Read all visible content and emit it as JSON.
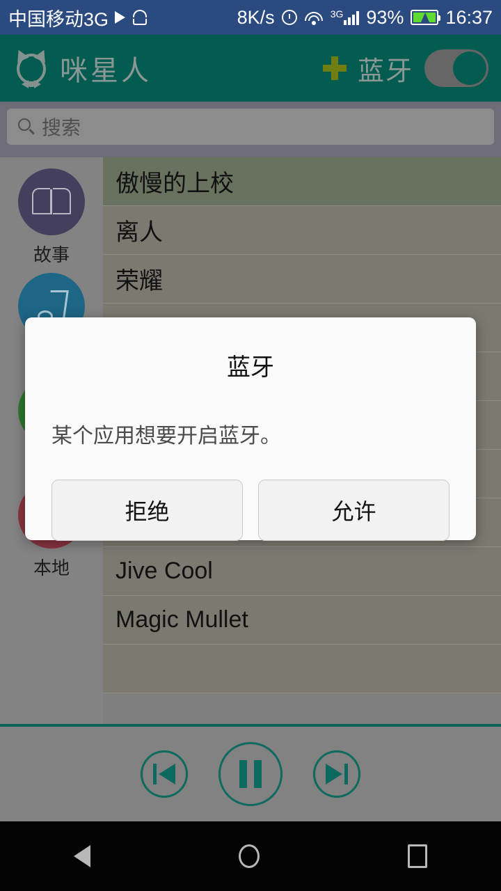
{
  "status_bar": {
    "carrier": "中国移动3G",
    "play_icon": "play-icon",
    "android_icon": "android-robot-icon",
    "net_speed": "8K/s",
    "alarm_icon": "alarm-icon",
    "wifi_icon": "wifi-icon",
    "signal_label": "3G",
    "signal_icon": "cellular-signal-icon",
    "battery_percent": "93%",
    "battery_icon": "battery-charging-icon",
    "clock": "16:37"
  },
  "app_bar": {
    "logo_icon": "cat-logo-icon",
    "title": "咪星人",
    "add_icon": "plus-icon",
    "bluetooth_label": "蓝牙",
    "bluetooth_toggle_state": "off",
    "background_color": "#045b50",
    "accent_color": "#6f7d12"
  },
  "search": {
    "icon": "search-icon",
    "placeholder": "搜索",
    "value": ""
  },
  "sidebar": {
    "items": [
      {
        "label": "故事",
        "icon": "book-icon",
        "color": "#453f5e"
      },
      {
        "label": "",
        "icon": "music-note-icon",
        "color": "#1d6685"
      },
      {
        "label": "",
        "icon": "green-category-icon",
        "color": "#2f7530"
      },
      {
        "label": "本地",
        "icon": "local-device-icon",
        "color": "#8a3440"
      }
    ]
  },
  "track_list": {
    "rows": [
      {
        "title": "傲慢的上校",
        "selected": true
      },
      {
        "title": "离人",
        "selected": false
      },
      {
        "title": "荣耀",
        "selected": false
      },
      {
        "title": "",
        "selected": false
      },
      {
        "title": "",
        "selected": false
      },
      {
        "title": "",
        "selected": false
      },
      {
        "title": "",
        "selected": false
      },
      {
        "title": "",
        "selected": false
      },
      {
        "title": "Jive Cool",
        "selected": false
      },
      {
        "title": "Magic Mullet",
        "selected": false
      },
      {
        "title": "",
        "selected": false
      }
    ]
  },
  "player": {
    "previous_icon": "skip-previous-icon",
    "pause_icon": "pause-icon",
    "next_icon": "skip-next-icon",
    "accent_color": "#0e6a5e"
  },
  "dialog": {
    "title": "蓝牙",
    "message": "某个应用想要开启蓝牙。",
    "deny_label": "拒绝",
    "allow_label": "允许"
  },
  "nav_bar": {
    "back_icon": "back-triangle-icon",
    "home_icon": "home-circle-icon",
    "recents_icon": "recents-square-icon"
  }
}
